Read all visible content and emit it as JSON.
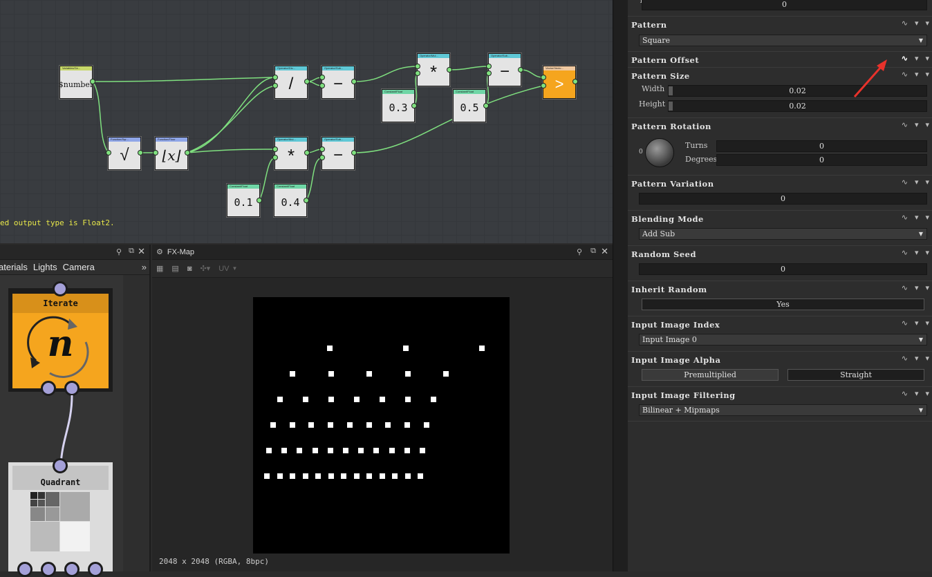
{
  "graph": {
    "status_message": "ed output type is Float2.",
    "nodes": {
      "variable": {
        "header": "Variables/Ge...",
        "label": "$number"
      },
      "sqrt": {
        "header": "Function/Sqr...",
        "label": "√"
      },
      "floor": {
        "header": "Function/Floor",
        "label": "⌊x⌋"
      },
      "div": {
        "header": "Operator/Div...",
        "label": "/"
      },
      "sub1": {
        "header": "Operator/Sub...",
        "label": "−"
      },
      "mul1": {
        "header": "Operator/Mul...",
        "label": "*"
      },
      "sub2": {
        "header": "Operator/Sub...",
        "label": "−"
      },
      "mul2": {
        "header": "Operator/Mul...",
        "label": "*"
      },
      "sub3": {
        "header": "Operator/Sub...",
        "label": "−"
      },
      "vector": {
        "header": "Vector/Vecto...",
        "label": ">"
      },
      "c03": {
        "header": "Constant/Float",
        "label": "0.3"
      },
      "c05": {
        "header": "Constant/Float",
        "label": "0.5"
      },
      "c01": {
        "header": "Constant/Float",
        "label": "0.1"
      },
      "c04": {
        "header": "Constant/Float",
        "label": "0.4"
      }
    }
  },
  "left_panel": {
    "tabs": [
      "aterials",
      "Lights",
      "Camera"
    ],
    "more": "»",
    "iterate_label": "Iterate",
    "iterate_symbol": "n",
    "quadrant_label": "Quadrant"
  },
  "fxmap": {
    "title": "FX-Map",
    "uv_label": "UV",
    "status": "2048 x 2048 (RGBA, 8bpc)",
    "rows": [
      3,
      5,
      7,
      9,
      11,
      13
    ]
  },
  "props": {
    "top_label": "Y",
    "top_value": "0",
    "pattern": {
      "title": "Pattern",
      "value": "Square"
    },
    "pattern_offset": {
      "title": "Pattern  Offset"
    },
    "pattern_size": {
      "title": "Pattern Size",
      "width_label": "Width",
      "width_value": "0.02",
      "height_label": "Height",
      "height_value": "0.02"
    },
    "pattern_rotation": {
      "title": "Pattern Rotation",
      "turns_label": "Turns",
      "turns_value": "0",
      "degrees_label": "Degrees",
      "degrees_value": "0",
      "dial_zero": "0"
    },
    "pattern_variation": {
      "title": "Pattern Variation",
      "value": "0"
    },
    "blending_mode": {
      "title": "Blending Mode",
      "value": "Add Sub"
    },
    "random_seed": {
      "title": "Random Seed",
      "value": "0"
    },
    "inherit_random": {
      "title": "Inherit Random",
      "value": "Yes"
    },
    "input_image_index": {
      "title": "Input Image Index",
      "value": "Input Image 0"
    },
    "input_image_alpha": {
      "title": "Input Image Alpha",
      "opt1": "Premultiplied",
      "opt2": "Straight"
    },
    "input_image_filtering": {
      "title": "Input Image Filtering",
      "value": "Bilinear + Mipmaps"
    }
  },
  "colors": {
    "accent_orange": "#f5a51e",
    "wire": "#7fe07f",
    "port": "#7fe07f",
    "annotation_arrow": "#e8322b"
  }
}
